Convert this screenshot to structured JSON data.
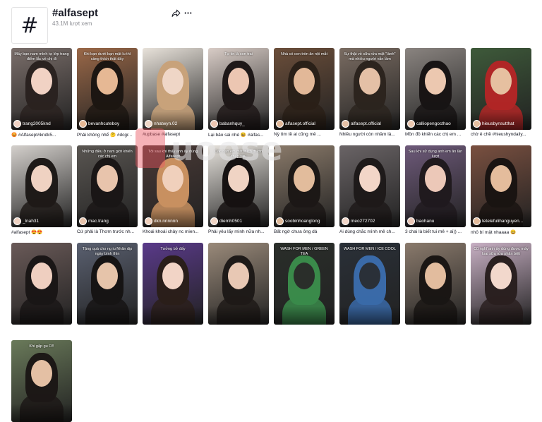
{
  "header": {
    "hashtag_symbol": "#",
    "title": "#alfasept",
    "views": "43.1M lượt xem",
    "share_icon": "share-icon",
    "more_icon": "more-icon"
  },
  "watermark": {
    "text": "uoose"
  },
  "videos": [
    {
      "overlay": "Mấy bạn nam mình tự lớp trang điểm lắc về chị đi",
      "username": "trang2005knd",
      "caption": "😡 #Alfasept#kndk5...",
      "bg": "#7a6e6a",
      "skin": "#f1d2c4",
      "hair": "#2a2220"
    },
    {
      "overlay": "Khi bạn dưới bạn mặt lu thì càng thích thật đấy",
      "username": "bevanhcuteboy",
      "caption": "Phải không nhể 🤔 #dcgr...",
      "bg": "#9a6848",
      "skin": "#e6b894",
      "hair": "#1c1612"
    },
    {
      "overlay": "",
      "username": "nhatwyn.02",
      "caption": "#upbase #alfasept",
      "bg": "#e8e2da",
      "skin": "#efd6c6",
      "hair": "#c8a27a"
    },
    {
      "overlay": "Tự tin là con trai",
      "username": "babanhquy_",
      "caption": "Lại bảo sai nhé 😆 #alfas...",
      "bg": "#d8ccc6",
      "skin": "#ecc6b2",
      "hair": "#1e1818"
    },
    {
      "overlay": "Nhà có con tròn ăn nội mắt",
      "username": "alfasept.official",
      "caption": "Nỳ tìm tề ai cũng mê ...",
      "bg": "#6b4e3a",
      "skin": "#e2b898",
      "hair": "#2a2018"
    },
    {
      "overlay": "Sự thật về sữa rửa mặt \"lành\" mà nhiều người vẫn lầm",
      "username": "alfasept.official",
      "caption": "Nhiều người còn nhầm lẫ...",
      "bg": "#7a6c62",
      "skin": "#e4c0a6",
      "hair": "#2c241e"
    },
    {
      "overlay": "",
      "username": "calliopengocthao",
      "caption": "Mồn đồ khiến các chị em ...",
      "bg": "#8a8480",
      "skin": "#ecc8b0",
      "hair": "#181414"
    },
    {
      "overlay": "",
      "username": "hieusbynsutthat",
      "caption": "chờ ê chề #hieushyndaily...",
      "bg": "#3e5a3a",
      "skin": "#e6c0a0",
      "hair": "#b02626"
    },
    {
      "overlay": "",
      "username": "_lnah31",
      "caption": "#alfasept 😍😍",
      "bg": "#d4d0cc",
      "skin": "#efd2c2",
      "hair": "#1e1a18"
    },
    {
      "overlay": "Những điều ở nam giới khiến các chị em",
      "username": "mac.trang",
      "caption": "Cứ phải là Thơm trước nh...",
      "bg": "#5a5652",
      "skin": "#e8c4ac",
      "hair": "#1a1616"
    },
    {
      "overlay": "Tôi sau khi thấy anh ấy dùng Alfasept",
      "username": "dkn.nnnnnn",
      "caption": "Khoái khoái chảy nc mien...",
      "bg": "#4a3a36",
      "skin": "#f0d0bc",
      "hair": "#c89060"
    },
    {
      "overlay": "Các bạn em mở thích đi lớn chấp sau",
      "username": "diemh0501",
      "caption": "Phải yêu lấy mình nữa nh...",
      "bg": "#e6e2dc",
      "skin": "#f0d4c4",
      "hair": "#161212"
    },
    {
      "overlay": "",
      "username": "soobinhoanglong",
      "caption": "Bất ngờ chưa ông dá",
      "bg": "#8a7a6a",
      "skin": "#e2bc9c",
      "hair": "#1c1816"
    },
    {
      "overlay": "",
      "username": "meo272702",
      "caption": "Ai dùng chắc mình mê ch...",
      "bg": "#6a6466",
      "skin": "#f2d6c8",
      "hair": "#1e1a1a"
    },
    {
      "overlay": "Sau khi sử dụng anh em ăn lần lượt",
      "username": "baohanu",
      "caption": "3 chai là biết tui mê + ai)) ...",
      "bg": "#6e5a7a",
      "skin": "#ecc8b8",
      "hair": "#201a1e"
    },
    {
      "overlay": "",
      "username": "tetelefulihanguyen...",
      "caption": "nhỏ bí mật nhaaaa 😆",
      "bg": "#7a5040",
      "skin": "#e4bc9c",
      "hair": "#1a1412"
    },
    {
      "overlay": "",
      "username": "",
      "caption": "",
      "bg": "#6a5a58",
      "skin": "#efcfc0",
      "hair": "#1a1616"
    },
    {
      "overlay": "Tặng quà cho ng iu Nhân dịp ngày bình thìn",
      "username": "",
      "caption": "",
      "bg": "#5a6070",
      "skin": "#e6c4aa",
      "hair": "#161414"
    },
    {
      "overlay": "Tưởng bở đấy",
      "username": "",
      "caption": "",
      "bg": "#5a3a8a",
      "skin": "#f2d4c6",
      "hair": "#2a1e1a"
    },
    {
      "overlay": "",
      "username": "",
      "caption": "",
      "bg": "#9a8a7a",
      "skin": "#e8c8b4",
      "hair": "#1e1a18"
    },
    {
      "overlay": "WASH FOR MEN / GREEN TEA",
      "username": "",
      "caption": "",
      "bg": "#2a2e2a",
      "skin": "#2a2e2a",
      "hair": "#3a8a4a"
    },
    {
      "overlay": "WASH FOR MEN / ICE COOL",
      "username": "",
      "caption": "",
      "bg": "#2a3038",
      "skin": "#2a3038",
      "hair": "#3a6aa8"
    },
    {
      "overlay": "",
      "username": "",
      "caption": "",
      "bg": "#8a7a6c",
      "skin": "#e2bc9e",
      "hair": "#1a1614"
    },
    {
      "overlay": "Cũ nghĩ anh ấy dùng được mấy loại sữa rửa phân biệt",
      "username": "",
      "caption": "",
      "bg": "#c8b0c4",
      "skin": "#f2d8cc",
      "hair": "#2a2020"
    },
    {
      "overlay": "Khi gặp gu O!!",
      "username": "",
      "caption": "",
      "bg": "#6a7a5a",
      "skin": "#e4c0a4",
      "hair": "#1c1816"
    }
  ]
}
